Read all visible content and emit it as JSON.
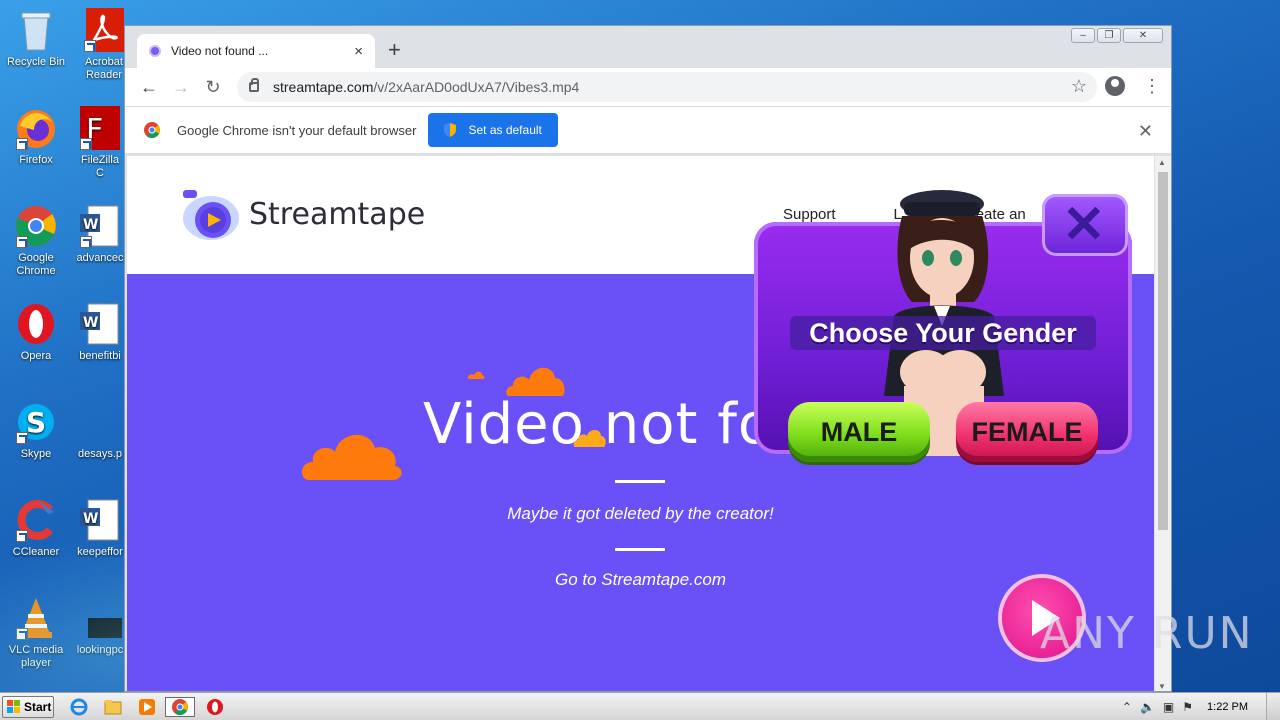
{
  "desktop": {
    "icons": [
      {
        "name": "recycle-bin",
        "label": "Recycle Bin"
      },
      {
        "name": "acrobat-reader",
        "label": "Acrobat Reader"
      },
      {
        "name": "firefox",
        "label": "Firefox"
      },
      {
        "name": "filezilla",
        "label": "FileZilla C"
      },
      {
        "name": "google-chrome",
        "label": "Google Chrome"
      },
      {
        "name": "advanced",
        "label": "advancec"
      },
      {
        "name": "opera",
        "label": "Opera"
      },
      {
        "name": "benefitbi",
        "label": "benefitbi"
      },
      {
        "name": "skype",
        "label": "Skype"
      },
      {
        "name": "desays",
        "label": "desays.p"
      },
      {
        "name": "ccleaner",
        "label": "CCleaner"
      },
      {
        "name": "keepeffor",
        "label": "keepeffor"
      },
      {
        "name": "vlc",
        "label": "VLC media player"
      },
      {
        "name": "lookingpo",
        "label": "lookingpc"
      }
    ]
  },
  "browser": {
    "tab": {
      "title": "Video not found ...",
      "close": "×"
    },
    "new_tab": "+",
    "url": {
      "host": "streamtape.com",
      "path": "/v/2xAarAD0odUxA7/Vibes3.mp4"
    },
    "infobar": {
      "message": "Google Chrome isn't your default browser",
      "button": "Set as default",
      "close": "✕"
    }
  },
  "page": {
    "brand": "Streamtape",
    "nav": [
      "Support",
      "L",
      "Create an"
    ],
    "heading": "Video not fou",
    "subtitle": "Maybe it got deleted by the creator!",
    "link": "Go to Streamtape.com"
  },
  "ad": {
    "title": "Choose Your Gender",
    "male": "MALE",
    "female": "FEMALE"
  },
  "watermark": "ANY RUN",
  "taskbar": {
    "start": "Start",
    "clock": "1:22 PM"
  },
  "colors": {
    "hero": "#6a50f7",
    "cloud": "#ff7a0c",
    "chrome_blue": "#1a73e8"
  }
}
